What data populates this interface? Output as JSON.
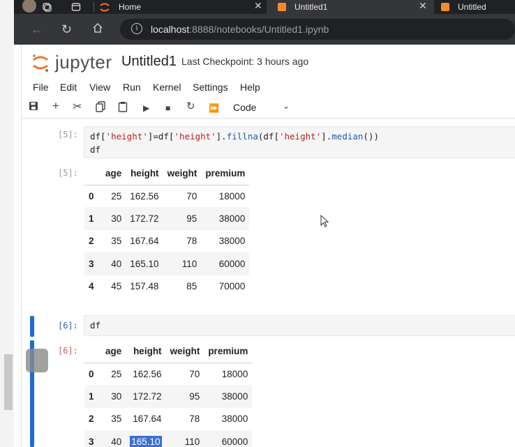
{
  "browser": {
    "tabs": [
      {
        "label": "Home"
      },
      {
        "label": "Untitled1"
      },
      {
        "label": "Untitled"
      }
    ],
    "url_host": "localhost",
    "url_rest": ":8888/notebooks/Untitled1.ipynb"
  },
  "jupyter": {
    "logo_text": "jupyter",
    "notebook_title": "Untitled1",
    "checkpoint": "Last Checkpoint: 3 hours ago",
    "menu": [
      "File",
      "Edit",
      "View",
      "Run",
      "Kernel",
      "Settings",
      "Help"
    ],
    "cell_type": "Code"
  },
  "cells": [
    {
      "in_prompt": "[5]:",
      "out_prompt": "[5]:",
      "code_line2": "df"
    },
    {
      "in_prompt": "[6]:",
      "out_prompt": "[6]:",
      "code": "df"
    }
  ],
  "table": {
    "columns": [
      "age",
      "height",
      "weight",
      "premium"
    ],
    "rows": [
      {
        "idx": "0",
        "age": "25",
        "height": "162.56",
        "weight": "70",
        "premium": "18000"
      },
      {
        "idx": "1",
        "age": "30",
        "height": "172.72",
        "weight": "95",
        "premium": "38000"
      },
      {
        "idx": "2",
        "age": "35",
        "height": "167.64",
        "weight": "78",
        "premium": "38000"
      },
      {
        "idx": "3",
        "age": "40",
        "height": "165.10",
        "weight": "110",
        "premium": "60000"
      },
      {
        "idx": "4",
        "age": "45",
        "height": "157.48",
        "weight": "85",
        "premium": "70000"
      }
    ]
  },
  "colors": {
    "accent": "#1a6bd6",
    "logo_orange": "#f37626"
  }
}
